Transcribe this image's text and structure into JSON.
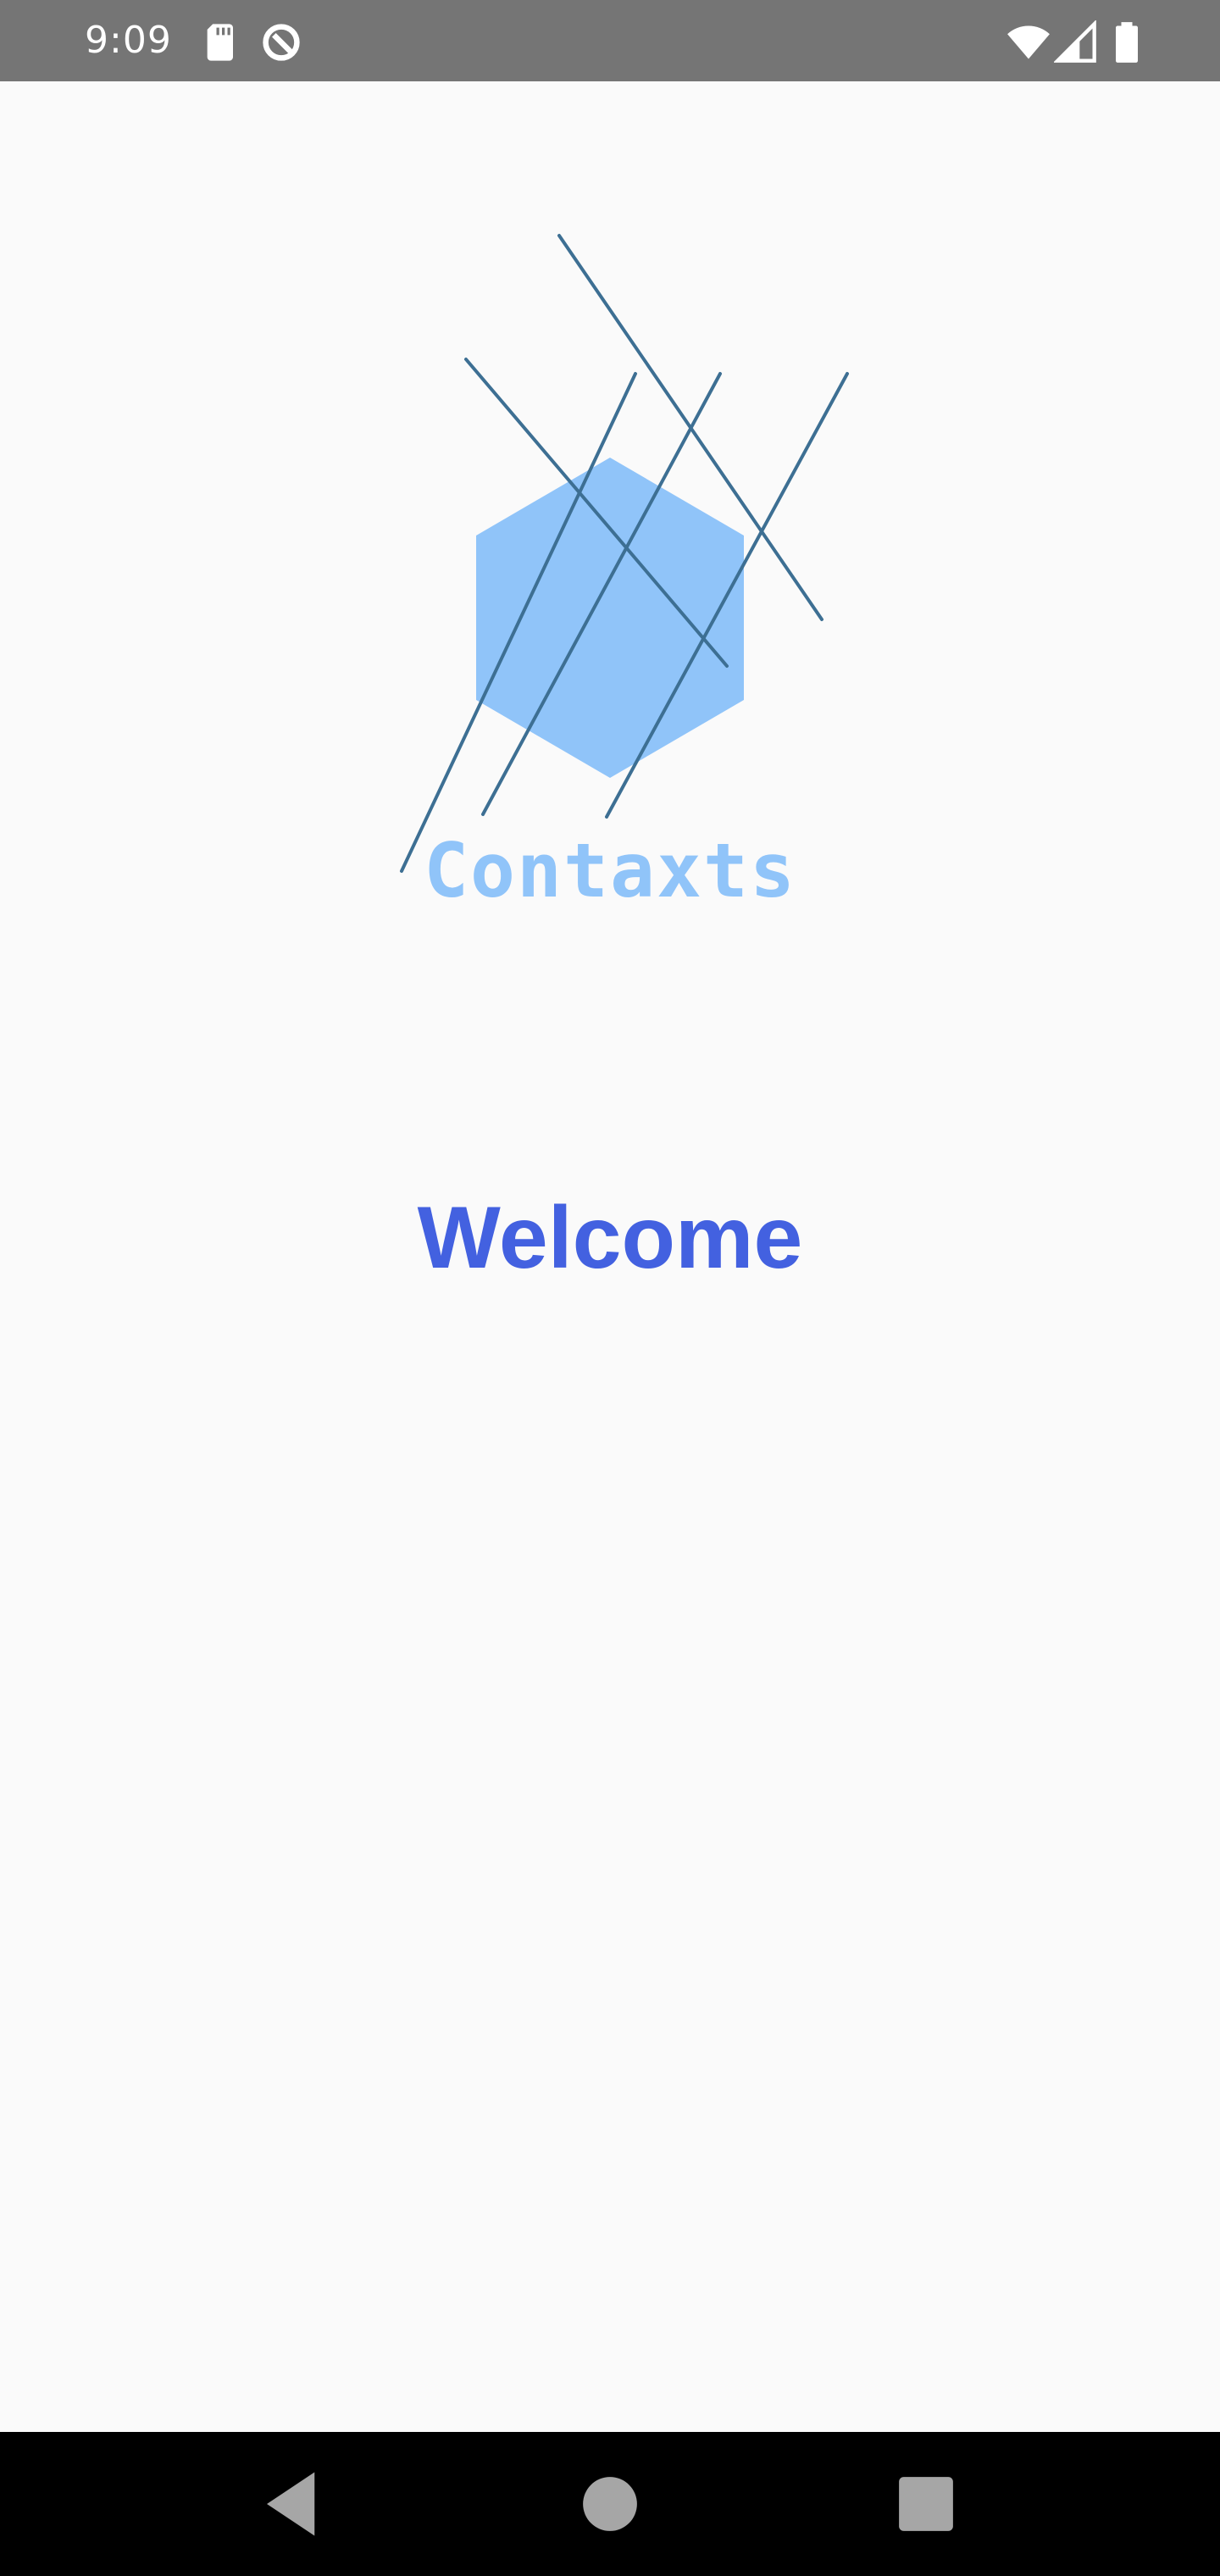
{
  "status_bar": {
    "time": "9:09",
    "icons": [
      "sd-card-icon",
      "data-saver-icon",
      "wifi-icon",
      "cell-signal-icon",
      "battery-icon"
    ]
  },
  "logo": {
    "text": "Contaxts",
    "hexagon_color": "#90c4f9",
    "line_color": "#3d6f93"
  },
  "welcome": {
    "text": "Welcome",
    "color": "#4361e0"
  },
  "nav_bar": {
    "buttons": [
      "back-icon",
      "home-icon",
      "recents-icon"
    ]
  },
  "colors": {
    "background": "#fafafa",
    "status_bar": "#757575",
    "nav_bar": "#000000"
  }
}
